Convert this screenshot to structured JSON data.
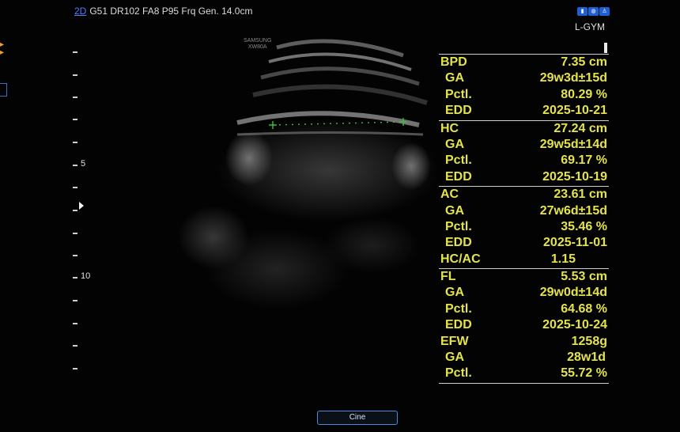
{
  "top_bar": {
    "mode": "2D",
    "params": "G51 DR102 FA8 P95 Frq Gen. 14.0cm",
    "preset": "L-GYM",
    "icons": [
      "probe-icon",
      "body-icon",
      "person-icon"
    ]
  },
  "vendor": {
    "brand": "SAMSUNG",
    "model": "XW80A"
  },
  "depth_scale": {
    "labels": {
      "five": "5",
      "ten": "10"
    }
  },
  "measurements": {
    "bpd": {
      "label": "BPD",
      "value": "7.35 cm",
      "ga_label": "GA",
      "ga": "29w3d±15d",
      "pctl_label": "Pctl.",
      "pctl": "80.29 %",
      "edd_label": "EDD",
      "edd": "2025-10-21"
    },
    "hc": {
      "label": "HC",
      "value": "27.24 cm",
      "ga_label": "GA",
      "ga": "29w5d±14d",
      "pctl_label": "Pctl.",
      "pctl": "69.17 %",
      "edd_label": "EDD",
      "edd": "2025-10-19"
    },
    "ac": {
      "label": "AC",
      "value": "23.61 cm",
      "ga_label": "GA",
      "ga": "27w6d±15d",
      "pctl_label": "Pctl.",
      "pctl": "35.46 %",
      "edd_label": "EDD",
      "edd": "2025-11-01",
      "ratio_label": "HC/AC",
      "ratio": "1.15"
    },
    "fl": {
      "label": "FL",
      "value": "5.53 cm",
      "ga_label": "GA",
      "ga": "29w0d±14d",
      "pctl_label": "Pctl.",
      "pctl": "64.68 %",
      "edd_label": "EDD",
      "edd": "2025-10-24"
    },
    "efw": {
      "label": "EFW",
      "value": "1258g",
      "ga_label": "GA",
      "ga": "28w1d",
      "pctl_label": "Pctl.",
      "pctl": "55.72 %"
    }
  },
  "controls": {
    "cine_label": "Cine"
  },
  "colors": {
    "measurement_text": "#e5e34c",
    "caliper": "#3fbf3f",
    "accent": "#4a7dff"
  }
}
